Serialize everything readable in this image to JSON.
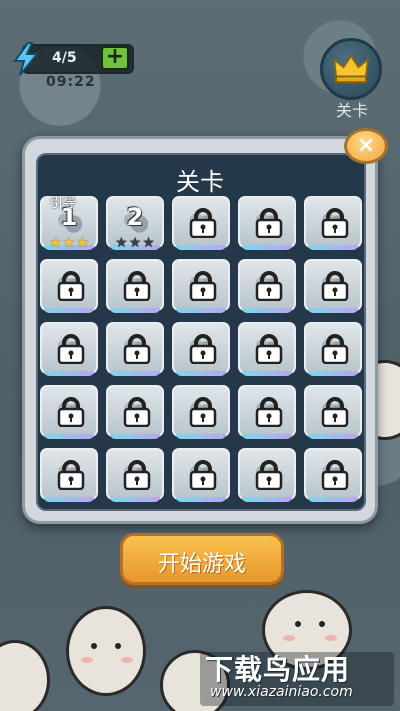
{
  "hud": {
    "energy": "4/5",
    "plus_label": "+",
    "timer": "09:22",
    "crown_label": "关卡",
    "icons": {
      "energy": "lightning-bolt-icon",
      "crown": "crown-icon"
    }
  },
  "panel": {
    "title": "关卡",
    "close_label": "×",
    "guide_label": "引导",
    "levels": [
      {
        "number": "1",
        "locked": false,
        "stars_earned": 3
      },
      {
        "number": "2",
        "locked": false,
        "stars_earned": 0
      },
      {
        "number": "",
        "locked": true
      },
      {
        "number": "",
        "locked": true
      },
      {
        "number": "",
        "locked": true
      },
      {
        "number": "",
        "locked": true
      },
      {
        "number": "",
        "locked": true
      },
      {
        "number": "",
        "locked": true
      },
      {
        "number": "",
        "locked": true
      },
      {
        "number": "",
        "locked": true
      },
      {
        "number": "",
        "locked": true
      },
      {
        "number": "",
        "locked": true
      },
      {
        "number": "",
        "locked": true
      },
      {
        "number": "",
        "locked": true
      },
      {
        "number": "",
        "locked": true
      },
      {
        "number": "",
        "locked": true
      },
      {
        "number": "",
        "locked": true
      },
      {
        "number": "",
        "locked": true
      },
      {
        "number": "",
        "locked": true
      },
      {
        "number": "",
        "locked": true
      },
      {
        "number": "",
        "locked": true
      },
      {
        "number": "",
        "locked": true
      },
      {
        "number": "",
        "locked": true
      },
      {
        "number": "",
        "locked": true
      },
      {
        "number": "",
        "locked": true
      },
      {
        "number": "",
        "locked": true
      },
      {
        "number": "",
        "locked": true
      },
      {
        "number": "",
        "locked": true
      },
      {
        "number": "",
        "locked": true
      },
      {
        "number": "",
        "locked": true
      }
    ]
  },
  "start_button": {
    "label": "开始游戏"
  },
  "watermark": {
    "title": "下载鸟应用",
    "url": "www.xiazainiao.com"
  },
  "colors": {
    "panel_bg": "#24384a",
    "start": "#f0a83a",
    "plus": "#6fc33a",
    "star_gold": "#f5c531"
  }
}
